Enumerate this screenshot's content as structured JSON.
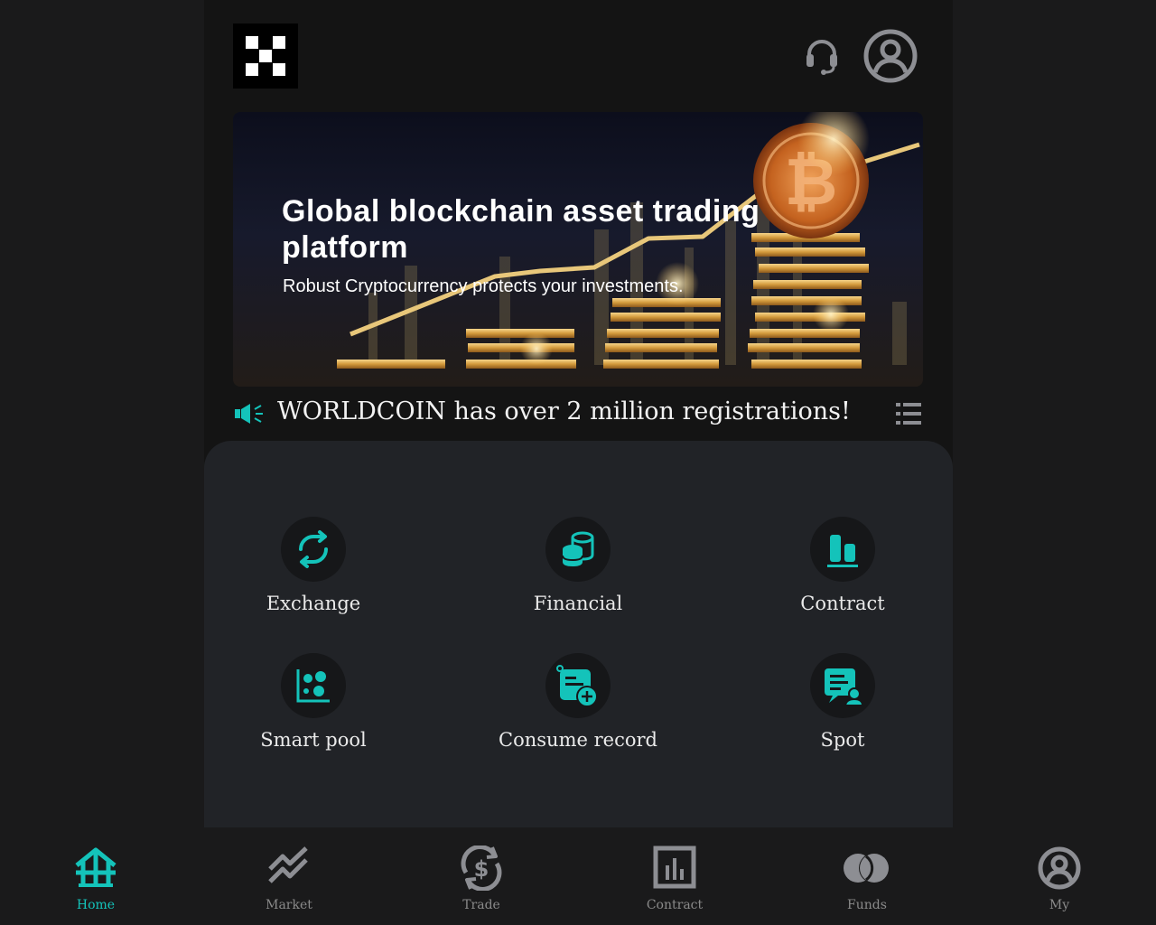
{
  "colors": {
    "accent": "#14c3ba",
    "icon_gray": "#8d8e93",
    "panel": "#212327",
    "background": "#141414"
  },
  "header": {
    "logo_icon": "okx-logo",
    "support_icon": "headset-icon",
    "profile_icon": "user-circle-icon"
  },
  "banner": {
    "title": "Global blockchain asset trading platform",
    "subtitle": "Robust Cryptocurrency protects your investments."
  },
  "notice": {
    "icon": "speaker-icon",
    "text": "WORLDCOIN has over 2 million registrations!",
    "menu_icon": "list-icon"
  },
  "features": [
    {
      "label": "Exchange",
      "icon": "exchange-icon"
    },
    {
      "label": "Financial",
      "icon": "coins-stack-icon"
    },
    {
      "label": "Contract",
      "icon": "bar-chart-icon"
    },
    {
      "label": "Smart pool",
      "icon": "scatter-dots-icon"
    },
    {
      "label": "Consume record",
      "icon": "record-add-icon"
    },
    {
      "label": "Spot",
      "icon": "spot-document-icon"
    }
  ],
  "tabs": [
    {
      "label": "Home",
      "icon": "home-icon",
      "active": true
    },
    {
      "label": "Market",
      "icon": "market-trend-icon",
      "active": false
    },
    {
      "label": "Trade",
      "icon": "trade-dollar-icon",
      "active": false
    },
    {
      "label": "Contract",
      "icon": "contract-chart-icon",
      "active": false
    },
    {
      "label": "Funds",
      "icon": "funds-circles-icon",
      "active": false
    },
    {
      "label": "My",
      "icon": "my-user-icon",
      "active": false
    }
  ]
}
